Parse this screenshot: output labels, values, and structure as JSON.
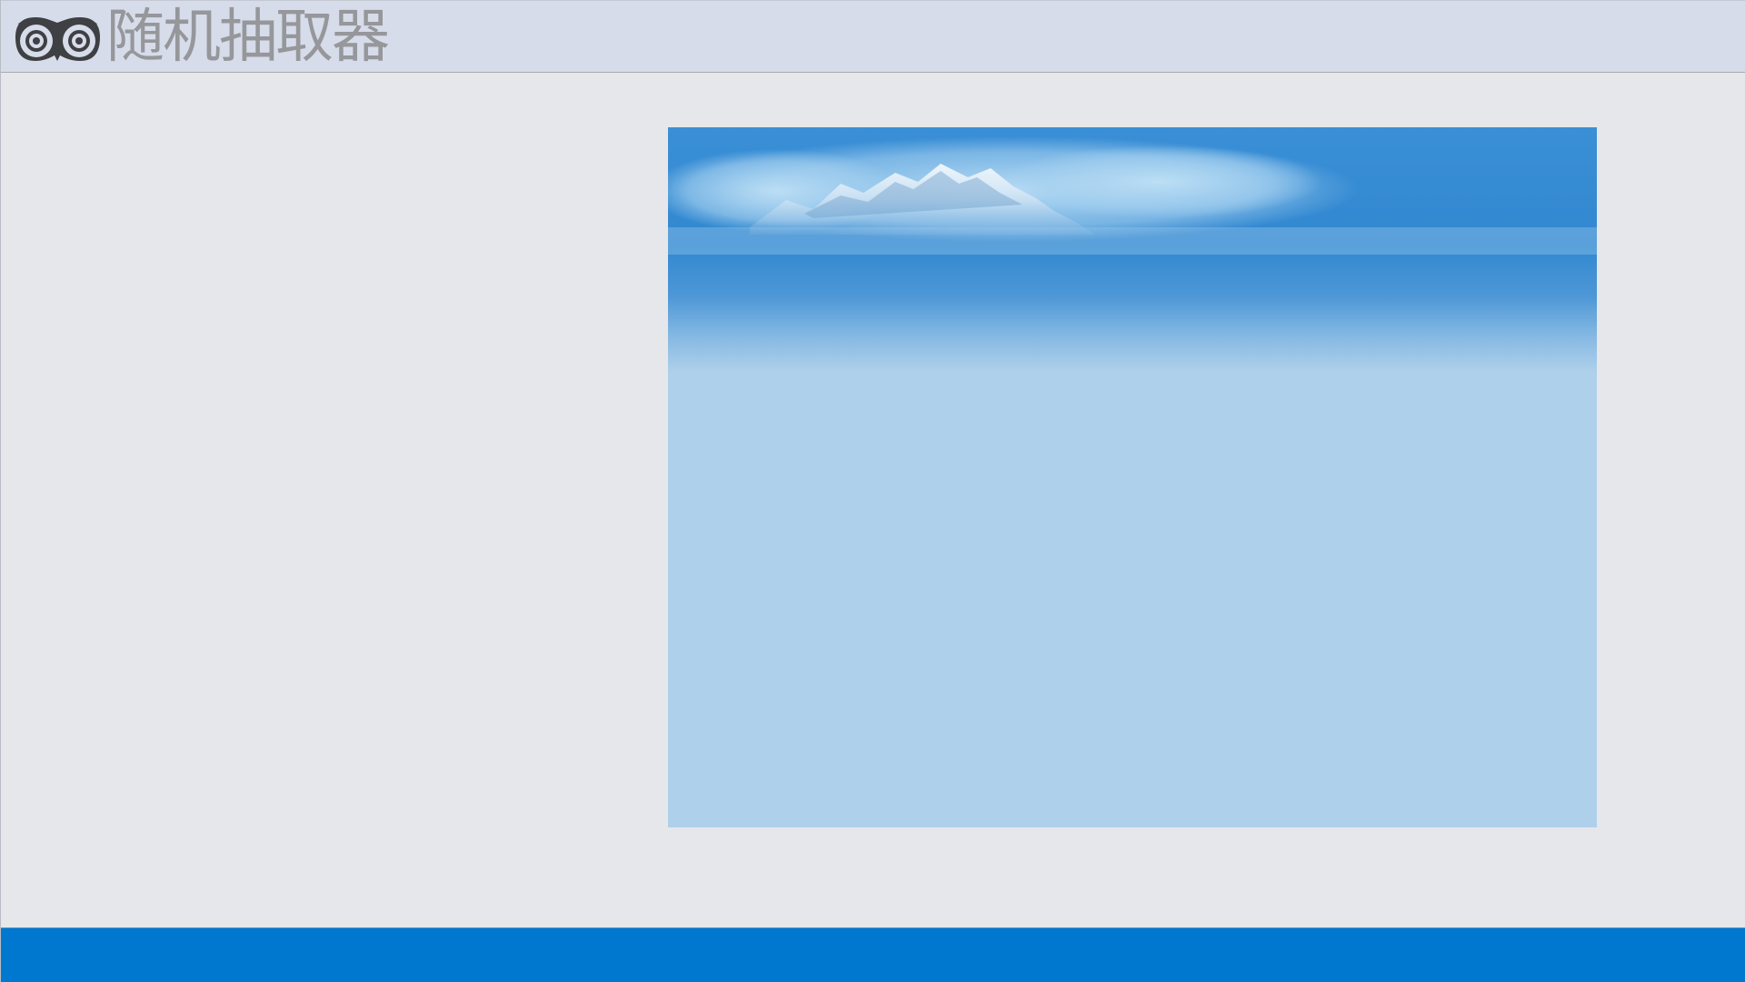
{
  "app": {
    "title": "随机抽取器",
    "logo_icon": "owl-eyes-icon"
  },
  "display_panel": {
    "image": "snow-mountain-sky-banner"
  },
  "colors": {
    "header_bg": "#d7dcea",
    "main_bg": "#e6e7ea",
    "title_text": "#96979b",
    "footer_bg": "#0078cf",
    "panel_light": "#afd0ea",
    "panel_dark": "#2f86d1"
  }
}
